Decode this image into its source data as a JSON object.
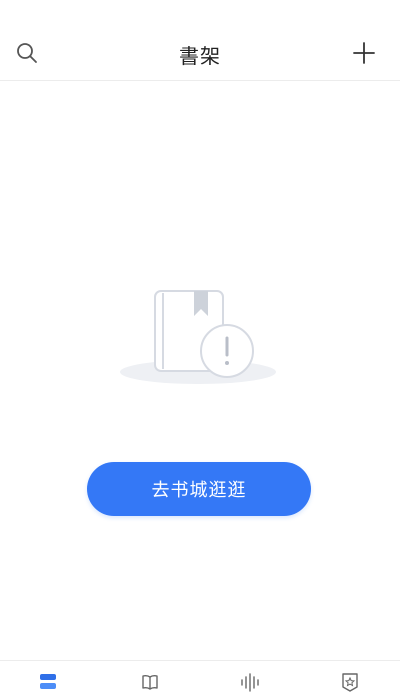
{
  "header": {
    "title": "書架",
    "search_icon": "search-icon",
    "add_icon": "plus-icon"
  },
  "empty_state": {
    "illustration_icon": "book-warning-icon"
  },
  "cta": {
    "label": "去书城逛逛"
  },
  "tabbar": {
    "tabs": [
      {
        "icon": "bookshelf-icon",
        "active": true
      },
      {
        "icon": "open-book-icon",
        "active": false
      },
      {
        "icon": "audio-wave-icon",
        "active": false
      },
      {
        "icon": "profile-star-icon",
        "active": false
      }
    ]
  },
  "colors": {
    "accent": "#3478f6",
    "icon_gray": "#666666",
    "divider": "#ececec"
  }
}
